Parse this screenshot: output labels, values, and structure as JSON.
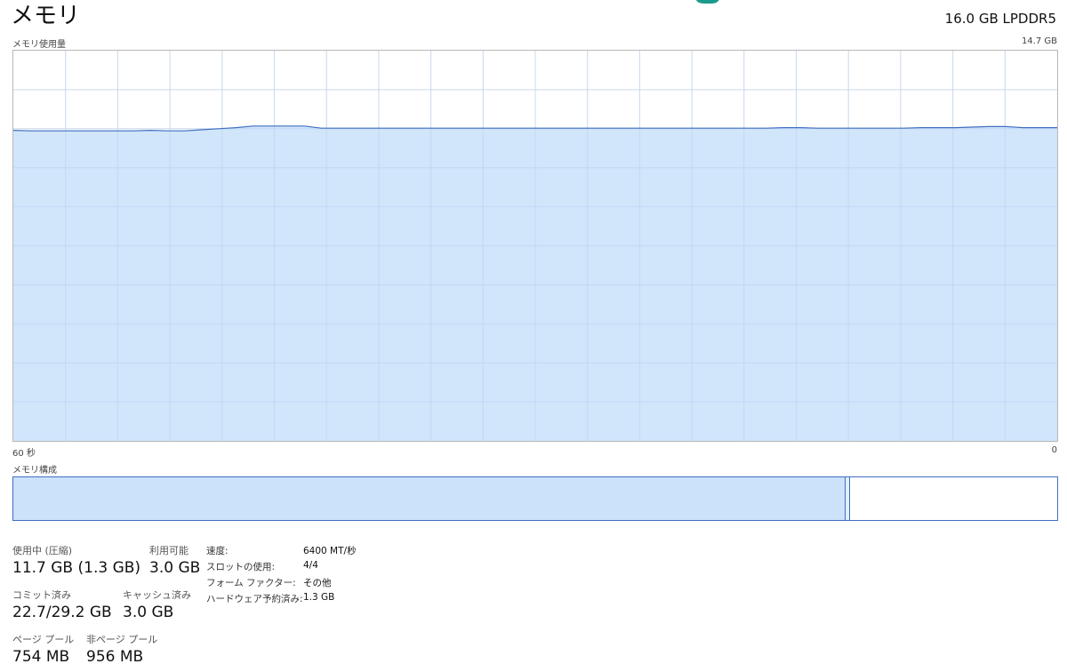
{
  "header": {
    "title": "メモリ",
    "spec": "16.0 GB LPDDR5"
  },
  "usage_graph": {
    "label": "メモリ使用量",
    "max_label": "14.7 GB",
    "time_left": "60 秒",
    "time_right": "0",
    "max_gb": 14.7,
    "values_gb": [
      11.7,
      11.68,
      11.68,
      11.68,
      11.68,
      11.68,
      11.68,
      11.68,
      11.7,
      11.68,
      11.68,
      11.72,
      11.76,
      11.8,
      11.86,
      11.86,
      11.86,
      11.86,
      11.78,
      11.78,
      11.78,
      11.78,
      11.78,
      11.78,
      11.78,
      11.78,
      11.78,
      11.78,
      11.78,
      11.78,
      11.78,
      11.78,
      11.78,
      11.78,
      11.78,
      11.78,
      11.78,
      11.78,
      11.78,
      11.78,
      11.78,
      11.78,
      11.78,
      11.78,
      11.78,
      11.8,
      11.8,
      11.78,
      11.78,
      11.78,
      11.78,
      11.78,
      11.78,
      11.8,
      11.8,
      11.8,
      11.82,
      11.84,
      11.84,
      11.8,
      11.8,
      11.8
    ],
    "fill_color": "#cce2fb",
    "line_color": "#3f6fc0",
    "grid_color": "#e6e6e6"
  },
  "composition": {
    "label": "メモリ構成",
    "used_fraction": 0.797,
    "modified_fraction": 0.004,
    "used_color": "#cce2fb",
    "border_color": "#3f6fc0"
  },
  "stats": {
    "in_use_label": "使用中 (圧縮)",
    "in_use_value": "11.7 GB (1.3 GB)",
    "available_label": "利用可能",
    "available_value": "3.0 GB",
    "committed_label": "コミット済み",
    "committed_value": "22.7/29.2 GB",
    "cached_label": "キャッシュ済み",
    "cached_value": "3.0 GB",
    "paged_label": "ページ プール",
    "paged_value": "754 MB",
    "nonpaged_label": "非ページ プール",
    "nonpaged_value": "956 MB"
  },
  "details": [
    {
      "label": "速度:",
      "value": "6400 MT/秒"
    },
    {
      "label": "スロットの使用:",
      "value": "4/4"
    },
    {
      "label": "フォーム ファクター:",
      "value": "その他"
    },
    {
      "label": "ハードウェア予約済み:",
      "value": "1.3 GB"
    }
  ]
}
